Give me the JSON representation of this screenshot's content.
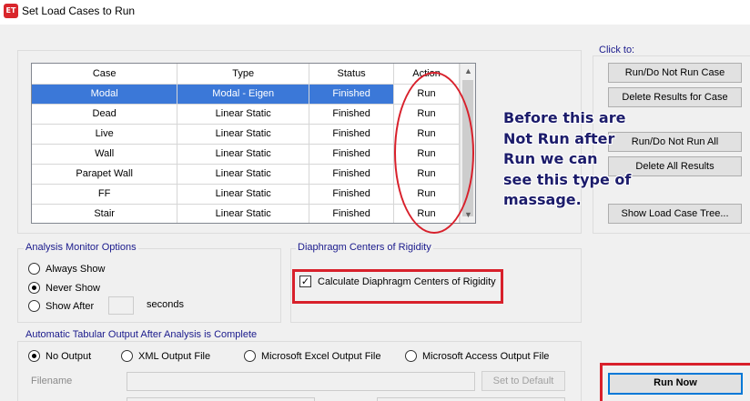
{
  "window": {
    "title": "Set Load Cases to Run",
    "icon_text": "ET"
  },
  "table": {
    "columns": [
      "Case",
      "Type",
      "Status",
      "Action"
    ],
    "rows": [
      [
        "Modal",
        "Modal - Eigen",
        "Finished",
        "Run"
      ],
      [
        "Dead",
        "Linear Static",
        "Finished",
        "Run"
      ],
      [
        "Live",
        "Linear Static",
        "Finished",
        "Run"
      ],
      [
        "Wall",
        "Linear Static",
        "Finished",
        "Run"
      ],
      [
        "Parapet Wall",
        "Linear Static",
        "Finished",
        "Run"
      ],
      [
        "FF",
        "Linear Static",
        "Finished",
        "Run"
      ],
      [
        "Stair",
        "Linear Static",
        "Finished",
        "Run"
      ]
    ],
    "selected_row": 0
  },
  "click_to": {
    "label": "Click to:",
    "run_do_not_run_case": "Run/Do Not Run Case",
    "delete_results_for_case": "Delete Results for Case",
    "run_do_not_run_all": "Run/Do Not Run All",
    "delete_all_results": "Delete All Results",
    "show_load_case_tree": "Show Load Case Tree..."
  },
  "analysis_monitor": {
    "label": "Analysis Monitor Options",
    "always_show": "Always Show",
    "never_show": "Never Show",
    "show_after": "Show After",
    "seconds": "seconds",
    "selected": "never_show"
  },
  "diaphragm": {
    "label": "Diaphragm Centers of Rigidity",
    "calculate_label": "Calculate Diaphragm Centers of Rigidity",
    "checked": true
  },
  "tabular_output": {
    "label": "Automatic Tabular Output After Analysis is Complete",
    "no_output": "No Output",
    "xml_output_file": "XML Output File",
    "excel_output_file": "Microsoft Excel Output File",
    "access_output_file": "Microsoft Access Output File",
    "selected": "no_output",
    "filename_label": "Filename",
    "set_to_default": "Set to Default"
  },
  "run_now": "Run Now",
  "annotation": {
    "text": "Before this are\nNot Run after\nRun we can\nsee this type of\nmassage."
  },
  "colors": {
    "selection": "#3b78d8",
    "group_label": "#1a1a8c",
    "annotation_text": "#1c1c6b",
    "highlight_red": "#d8202b",
    "default_button_border": "#0078d7"
  }
}
